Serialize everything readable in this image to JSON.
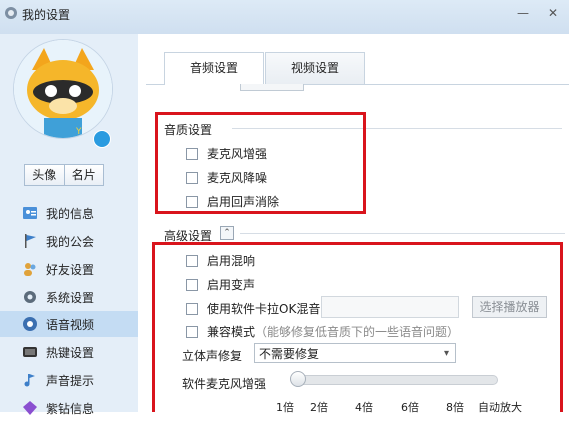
{
  "window": {
    "title": "我的设置",
    "minimize": "—",
    "close": "✕"
  },
  "sidebar": {
    "buttons": [
      "头像",
      "名片"
    ],
    "items": [
      {
        "label": "我的信息",
        "icon": "user-info-icon"
      },
      {
        "label": "我的公会",
        "icon": "guild-flag-icon"
      },
      {
        "label": "好友设置",
        "icon": "friends-icon"
      },
      {
        "label": "系统设置",
        "icon": "gear-icon"
      },
      {
        "label": "语音视频",
        "icon": "voice-video-icon",
        "active": true
      },
      {
        "label": "热键设置",
        "icon": "hotkey-icon"
      },
      {
        "label": "声音提示",
        "icon": "sound-note-icon"
      },
      {
        "label": "紫钻信息",
        "icon": "purple-diamond-icon"
      }
    ]
  },
  "tabs": [
    {
      "label": "音频设置",
      "active": true
    },
    {
      "label": "视频设置",
      "active": false
    }
  ],
  "audio_quality": {
    "heading": "音质设置",
    "options": [
      {
        "label": "麦克风增强",
        "checked": false
      },
      {
        "label": "麦克风降噪",
        "checked": false
      },
      {
        "label": "启用回声消除",
        "checked": false
      }
    ]
  },
  "advanced": {
    "heading": "高级设置",
    "collapse_glyph": "⌃",
    "options": [
      {
        "label": "启用混响",
        "checked": false
      },
      {
        "label": "启用变声",
        "checked": false
      },
      {
        "label": "使用软件卡拉OK混音",
        "checked": false
      },
      {
        "label": "兼容模式",
        "hint": "（能够修复低音质下的一些语音问题）",
        "checked": false
      }
    ],
    "player_button": "选择播放器",
    "stereo_label": "立体声修复",
    "stereo_value": "不需要修复",
    "mic_boost_label": "软件麦克风增强",
    "mic_boost_level": 0,
    "ticks": [
      "1倍",
      "2倍",
      "4倍",
      "6倍",
      "8倍",
      "自动放大"
    ]
  },
  "colors": {
    "highlight": "#d9141c",
    "sidebar_bg": "#e4eef8",
    "active_item": "#c4dcf3"
  }
}
